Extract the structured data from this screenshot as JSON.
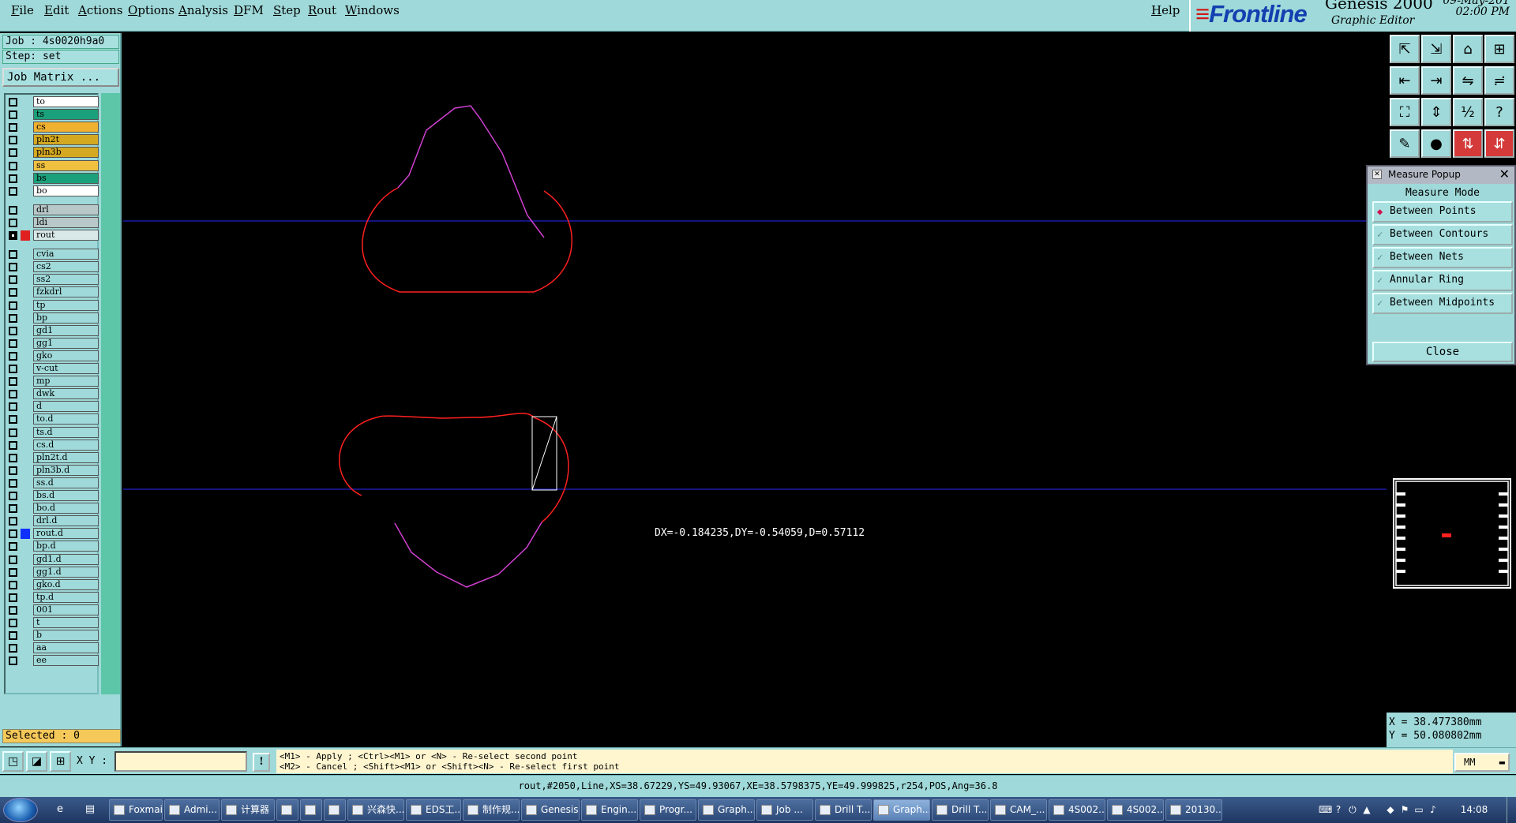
{
  "menu": [
    "File",
    "Edit",
    "Actions",
    "Options",
    "Analysis",
    "DFM",
    "Step",
    "Rout",
    "Windows"
  ],
  "help": "Help",
  "brand": {
    "logo_main": "Frontline",
    "app": "Genesis 2000",
    "subtitle": "Graphic Editor",
    "date": "09-May-201",
    "time": "02:00 PM"
  },
  "job_label": "Job : 4s0020h9a0",
  "step_label": "Step: set",
  "job_matrix": "Job Matrix ...",
  "layers": [
    {
      "name": "to",
      "bg": "#ffffff"
    },
    {
      "name": "ts",
      "bg": "#1aa07a"
    },
    {
      "name": "cs",
      "bg": "#f0b030"
    },
    {
      "name": "pln2t",
      "bg": "#d4a820"
    },
    {
      "name": "pln3b",
      "bg": "#d4a820"
    },
    {
      "name": "ss",
      "bg": "#f0c040"
    },
    {
      "name": "bs",
      "bg": "#1aa07a"
    },
    {
      "name": "bo",
      "bg": "#ffffff"
    },
    {
      "name": "drl",
      "bg": "#b8c8c8"
    },
    {
      "name": "ldi",
      "bg": "#b8c8c8"
    },
    {
      "name": "rout",
      "bg": "#d8e8e8",
      "active": true,
      "swatch": "#e02020"
    },
    {
      "name": "cvia"
    },
    {
      "name": "cs2"
    },
    {
      "name": "ss2"
    },
    {
      "name": "fzkdrl"
    },
    {
      "name": "tp"
    },
    {
      "name": "bp"
    },
    {
      "name": "gd1"
    },
    {
      "name": "gg1"
    },
    {
      "name": "gko"
    },
    {
      "name": "v-cut"
    },
    {
      "name": "mp"
    },
    {
      "name": "dwk"
    },
    {
      "name": "d"
    },
    {
      "name": "to.d"
    },
    {
      "name": "ts.d"
    },
    {
      "name": "cs.d"
    },
    {
      "name": "pln2t.d"
    },
    {
      "name": "pln3b.d"
    },
    {
      "name": "ss.d"
    },
    {
      "name": "bs.d"
    },
    {
      "name": "bo.d"
    },
    {
      "name": "drl.d"
    },
    {
      "name": "rout.d",
      "swatch": "#1030ff"
    },
    {
      "name": "bp.d"
    },
    {
      "name": "gd1.d"
    },
    {
      "name": "gg1.d"
    },
    {
      "name": "gko.d"
    },
    {
      "name": "tp.d"
    },
    {
      "name": "001"
    },
    {
      "name": "t"
    },
    {
      "name": "b"
    },
    {
      "name": "aa"
    },
    {
      "name": "ee"
    }
  ],
  "selected": "Selected : 0",
  "measurement": "DX=-0.184235,DY=-0.54059,D=0.57112",
  "measure_popup": {
    "title": "Measure Popup",
    "mode_label": "Measure Mode",
    "options": [
      "Between Points",
      "Between Contours",
      "Between Nets",
      "Annular Ring",
      "Between Midpoints"
    ],
    "selected": "Between Points",
    "close": "Close"
  },
  "coords": {
    "x": "X = 38.477380mm",
    "y": "Y = 50.080802mm"
  },
  "prompt": {
    "xy_label": "X Y :",
    "xy_value": "",
    "hint1": "<M1> - Apply  ; <Ctrl><M1> or <N> - Re-select second point",
    "hint2": "<M2> - Cancel ; <Shift><M1> or <Shift><N> - Re-select first point",
    "units": "MM"
  },
  "status": "rout,#2050,Line,XS=38.67229,YS=49.93067,XE=38.5798375,YE=49.999825,r254,POS,Ang=36.8",
  "taskbar": {
    "tasks": [
      "Foxmail",
      "Admi...",
      "计算器",
      "",
      "",
      "",
      "兴森快...",
      "EDS工...",
      "制作规...",
      "Genesis",
      "Engin...",
      "Progr...",
      "Graph...",
      "Job ...",
      "Drill T...",
      "Graph...",
      "Drill T...",
      "CAM_...",
      "4S002...",
      "4S002...",
      "20130..."
    ],
    "clock": "14:08"
  },
  "colors": {
    "cyan": "#9fd9d9",
    "route": "#ff2020",
    "outline": "#d040d0",
    "guide": "#1a1aa8"
  }
}
